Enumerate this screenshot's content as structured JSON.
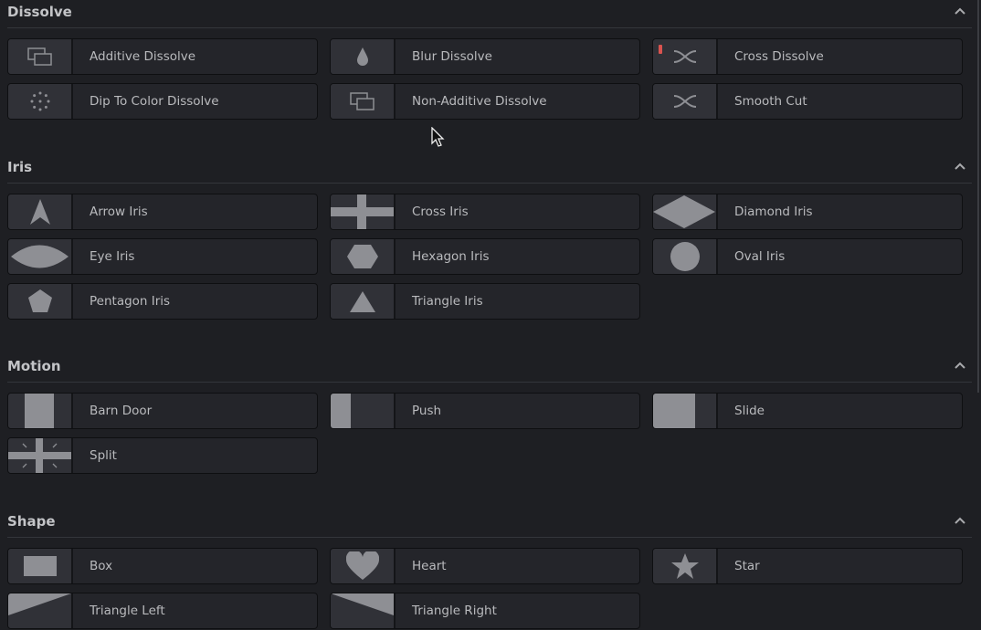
{
  "sections": [
    {
      "title": "Dissolve",
      "items": [
        {
          "label": "Additive Dissolve",
          "icon": "overlap-rects-icon"
        },
        {
          "label": "Blur Dissolve",
          "icon": "drop-icon"
        },
        {
          "label": "Cross Dissolve",
          "icon": "cross-arrows-icon",
          "flagged": true
        },
        {
          "label": "Dip To Color Dissolve",
          "icon": "dots-circle-icon"
        },
        {
          "label": "Non-Additive Dissolve",
          "icon": "overlap-rects-icon"
        },
        {
          "label": "Smooth Cut",
          "icon": "cross-arrows-icon"
        }
      ]
    },
    {
      "title": "Iris",
      "items": [
        {
          "label": "Arrow Iris",
          "icon": "arrow-shape-icon"
        },
        {
          "label": "Cross Iris",
          "icon": "cross-shape-icon"
        },
        {
          "label": "Diamond Iris",
          "icon": "diamond-icon"
        },
        {
          "label": "Eye Iris",
          "icon": "eye-shape-icon"
        },
        {
          "label": "Hexagon Iris",
          "icon": "hexagon-icon"
        },
        {
          "label": "Oval Iris",
          "icon": "circle-icon"
        },
        {
          "label": "Pentagon Iris",
          "icon": "pentagon-icon"
        },
        {
          "label": "Triangle Iris",
          "icon": "triangle-icon"
        }
      ]
    },
    {
      "title": "Motion",
      "items": [
        {
          "label": "Barn Door",
          "icon": "barn-door-icon"
        },
        {
          "label": "Push",
          "icon": "push-icon"
        },
        {
          "label": "Slide",
          "icon": "slide-icon"
        },
        {
          "label": "Split",
          "icon": "split-icon"
        }
      ]
    },
    {
      "title": "Shape",
      "items": [
        {
          "label": "Box",
          "icon": "box-icon"
        },
        {
          "label": "Heart",
          "icon": "heart-icon"
        },
        {
          "label": "Star",
          "icon": "star-icon"
        },
        {
          "label": "Triangle Left",
          "icon": "triangle-left-icon"
        },
        {
          "label": "Triangle Right",
          "icon": "triangle-right-icon"
        }
      ]
    }
  ],
  "colors": {
    "flag": "#d9534f",
    "icon": "#8e8f94"
  }
}
